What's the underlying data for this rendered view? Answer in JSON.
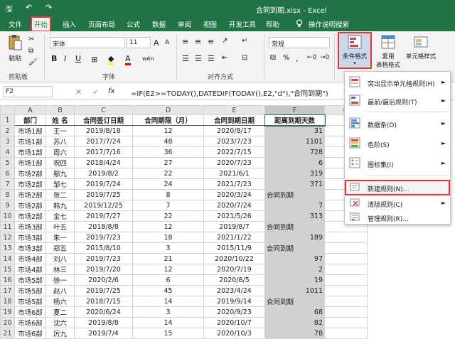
{
  "window": {
    "title": "合同到期.xlsx  -  Excel"
  },
  "quick_access": {
    "save": "🖫",
    "undo": "↶",
    "redo": "↷"
  },
  "tabs": [
    "文件",
    "开始",
    "插入",
    "页面布局",
    "公式",
    "数据",
    "审阅",
    "视图",
    "开发工具",
    "帮助",
    "操作说明搜索"
  ],
  "tell_me_icon": "lightbulb-icon",
  "ribbon": {
    "paste": "粘贴",
    "clipboard": "剪贴板",
    "font_name": "宋体",
    "font_size": "11",
    "bold": "B",
    "italic": "I",
    "underline": "U",
    "grow": "A",
    "shrink": "A",
    "font_color": "A",
    "phonetic": "wén",
    "font_group": "字体",
    "align_group": "对齐方式",
    "number_format": "常规",
    "percent": "%",
    "comma": ",",
    "cond_format": "条件格式",
    "table_format_1": "套用",
    "table_format_2": "表格格式",
    "cell_styles": "单元格样式"
  },
  "formula": {
    "cell_ref": "F2",
    "cancel": "✕",
    "enter": "✓",
    "fx": "fx",
    "content": "=IF(E2>=TODAY(),DATEDIF(TODAY(),E2,\"d\"),\"合同到期\")"
  },
  "columns": [
    "A",
    "B",
    "C",
    "D",
    "E",
    "F",
    "G"
  ],
  "headers": [
    "部门",
    "姓  名",
    "合同签订日期",
    "合同期限（月）",
    "合同到期日期",
    "距离到期天数"
  ],
  "rows": [
    [
      "市场1部",
      "王一",
      "2019/8/18",
      "12",
      "2020/8/17",
      "31"
    ],
    [
      "市场1部",
      "苏八",
      "2017/7/24",
      "48",
      "2023/7/23",
      "1101"
    ],
    [
      "市场1部",
      "周六",
      "2017/7/16",
      "36",
      "2022/7/15",
      "728"
    ],
    [
      "市场1部",
      "祝四",
      "2018/4/24",
      "27",
      "2020/7/23",
      "6"
    ],
    [
      "市场2部",
      "鄢九",
      "2019/8/2",
      "22",
      "2021/6/1",
      "319"
    ],
    [
      "市场2部",
      "邹七",
      "2019/7/24",
      "24",
      "2021/7/23",
      "371"
    ],
    [
      "市场2部",
      "张二",
      "2019/7/25",
      "8",
      "2020/3/24",
      "合同到期"
    ],
    [
      "市场2部",
      "韩九",
      "2019/12/25",
      "7",
      "2020/7/24",
      "7"
    ],
    [
      "市场2部",
      "金七",
      "2019/7/27",
      "22",
      "2021/5/26",
      "313"
    ],
    [
      "市场3部",
      "叶五",
      "2018/8/8",
      "12",
      "2019/8/7",
      "合同到期"
    ],
    [
      "市场3部",
      "朱一",
      "2019/7/23",
      "18",
      "2021/1/22",
      "189"
    ],
    [
      "市场3部",
      "郑五",
      "2015/8/10",
      "3",
      "2015/11/9",
      "合同到期"
    ],
    [
      "市场4部",
      "刘八",
      "2019/7/23",
      "21",
      "2020/10/22",
      "97"
    ],
    [
      "市场4部",
      "林三",
      "2019/7/20",
      "12",
      "2020/7/19",
      "2"
    ],
    [
      "市场5部",
      "徐一",
      "2020/2/6",
      "6",
      "2020/8/5",
      "19"
    ],
    [
      "市场5部",
      "赵八",
      "2019/7/25",
      "45",
      "2023/4/24",
      "1011"
    ],
    [
      "市场5部",
      "杨六",
      "2018/7/15",
      "14",
      "2019/9/14",
      "合同到期"
    ],
    [
      "市场6部",
      "夏二",
      "2020/6/24",
      "3",
      "2020/9/23",
      "68"
    ],
    [
      "市场6部",
      "沈六",
      "2019/8/8",
      "14",
      "2020/10/7",
      "82"
    ],
    [
      "市场6部",
      "厉九",
      "2019/7/4",
      "15",
      "2020/10/3",
      "78"
    ]
  ],
  "menu": [
    {
      "label": "突出显示单元格规则(H)",
      "icon": "highlight-rules-icon",
      "arrow": "►"
    },
    {
      "label": "最前/最后规则(T)",
      "icon": "top-bottom-rules-icon",
      "arrow": "►"
    },
    {
      "label": "数据条(D)",
      "icon": "data-bars-icon",
      "arrow": "►"
    },
    {
      "label": "色阶(S)",
      "icon": "color-scales-icon",
      "arrow": "►"
    },
    {
      "label": "图标集(I)",
      "icon": "icon-sets-icon",
      "arrow": "►"
    },
    {
      "label": "新建规则(N)...",
      "icon": "new-rule-icon",
      "arrow": ""
    },
    {
      "label": "清除规则(C)",
      "icon": "clear-rules-icon",
      "arrow": "►"
    },
    {
      "label": "管理规则(R)...",
      "icon": "manage-rules-icon",
      "arrow": ""
    }
  ]
}
